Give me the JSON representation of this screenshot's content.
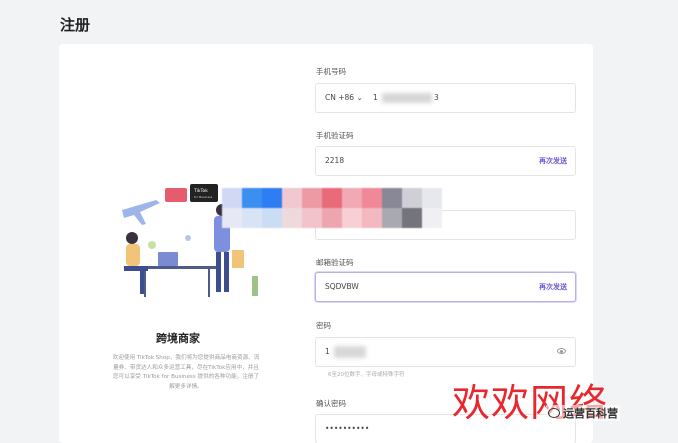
{
  "page": {
    "title": "注册"
  },
  "brand": {
    "title": "跨境商家",
    "description": "欢迎使用 TikTok Shop，我们将为您提供商品电商资源、流量券、带货达人和众多运营工具，尽在TikTok应用中，并且您可以享受 TikTok for Business 提供的各种功能，注册了解更多详情。",
    "bubble_tiktok": "TikTok",
    "bubble_sub": "for Business"
  },
  "form": {
    "phone": {
      "label": "手机号码",
      "country_code": "CN +86 ⌄",
      "partial_prefix": "1",
      "partial_suffix": "3"
    },
    "phone_code": {
      "label": "手机验证码",
      "value": "2218",
      "resend": "再次发送"
    },
    "email_code": {
      "label": "邮箱验证码",
      "value": "SQDVBW",
      "resend": "再次发送"
    },
    "password": {
      "label": "密码",
      "value": "1",
      "hint": "6至20位数字、字母或特殊字符"
    },
    "confirm_password": {
      "label": "确认密码",
      "value": "••••••••••"
    }
  },
  "watermark": {
    "text": "欢欢网络",
    "account": "运营百科营"
  },
  "colors": {
    "accent": "#6e5ad6",
    "watermark": "#e8282e"
  },
  "mosaic_colors": [
    "#d0d8f4",
    "#3a8ff0",
    "#2f7df2",
    "#f0c8cf",
    "#ee9aa4",
    "#e96b7a",
    "#f3a9b4",
    "#f08898",
    "#888896",
    "#cfcfd5",
    "#e7e7ee",
    "#e6e8f5",
    "#d9e3f6",
    "#cbdcf5",
    "#eed9dd",
    "#f2c3cb",
    "#eda6b0",
    "#f7cfd5",
    "#f3b8c0",
    "#a9a9b2",
    "#74747d",
    "#f0f0f4"
  ]
}
